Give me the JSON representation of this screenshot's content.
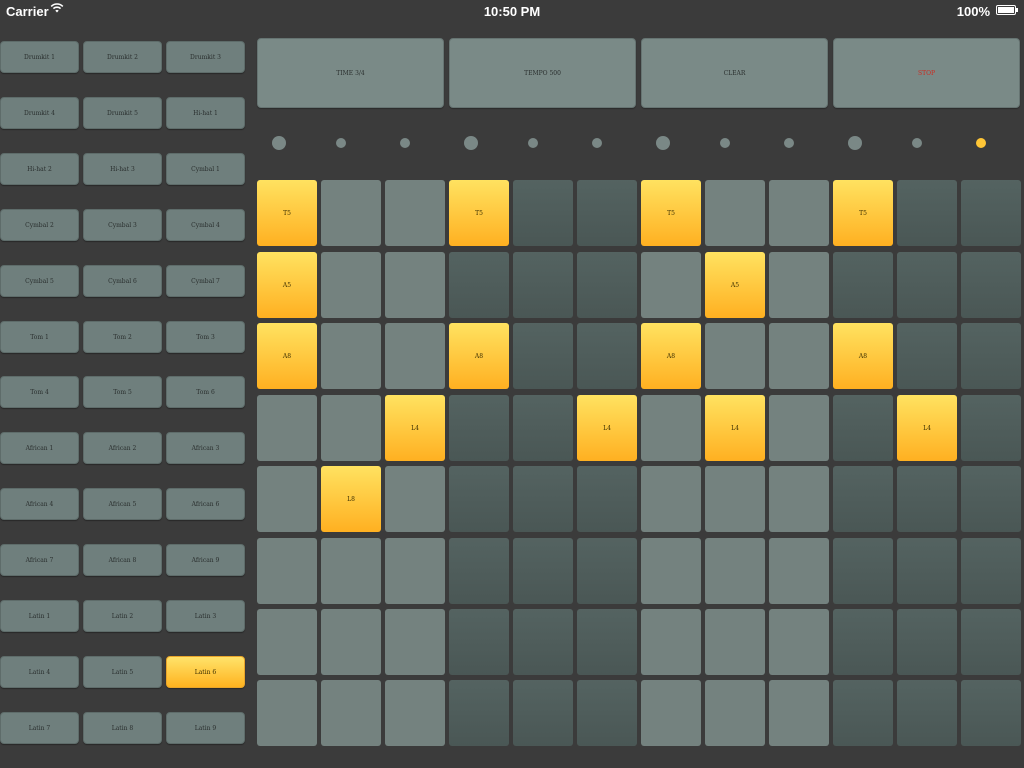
{
  "status_bar": {
    "carrier": "Carrier",
    "time": "10:50 PM",
    "battery": "100%"
  },
  "sounds": [
    "Drumkit 1",
    "Drumkit 2",
    "Drumkit 3",
    "Drumkit 4",
    "Drumkit 5",
    "Hi-hat 1",
    "Hi-hat 2",
    "Hi-hat 3",
    "Cymbal 1",
    "Cymbal 2",
    "Cymbal 3",
    "Cymbal 4",
    "Cymbal 5",
    "Cymbal 6",
    "Cymbal 7",
    "Tom 1",
    "Tom 2",
    "Tom 3",
    "Tom 4",
    "Tom 5",
    "Tom 6",
    "African 1",
    "African 2",
    "African 3",
    "African 4",
    "African 5",
    "African 6",
    "African 7",
    "African 8",
    "African 9",
    "Latin 1",
    "Latin 2",
    "Latin 3",
    "Latin 4",
    "Latin 5",
    "Latin 6",
    "Latin 7",
    "Latin 8",
    "Latin 9"
  ],
  "selected_sound_index": 35,
  "controls": {
    "time": "TIME 3/4",
    "tempo": "TEMPO 500",
    "clear": "CLEAR",
    "stop": "STOP"
  },
  "colors": {
    "stop_text": "#cc2a1f",
    "accent": "#ffc636",
    "pad_light": "#74827f",
    "pad_dark": "#4f5c5a"
  },
  "beat_dots": [
    {
      "size": "big"
    },
    {
      "size": "small"
    },
    {
      "size": "small"
    },
    {
      "size": "big"
    },
    {
      "size": "small"
    },
    {
      "size": "small"
    },
    {
      "size": "big"
    },
    {
      "size": "small"
    },
    {
      "size": "small"
    },
    {
      "size": "big"
    },
    {
      "size": "small"
    },
    {
      "size": "small",
      "active": true
    }
  ],
  "column_shade": [
    "light",
    "light",
    "light",
    "dark",
    "dark",
    "dark",
    "light",
    "light",
    "light",
    "dark",
    "dark",
    "dark"
  ],
  "grid": [
    [
      "T5",
      "",
      "",
      "T5",
      "",
      "",
      "T5",
      "",
      "",
      "T5",
      "",
      ""
    ],
    [
      "A5",
      "",
      "",
      "",
      "",
      "",
      "",
      "A5",
      "",
      "",
      "",
      ""
    ],
    [
      "A8",
      "",
      "",
      "A8",
      "",
      "",
      "A8",
      "",
      "",
      "A8",
      "",
      ""
    ],
    [
      "",
      "",
      "L4",
      "",
      "",
      "L4",
      "",
      "L4",
      "",
      "",
      "L4",
      ""
    ],
    [
      "",
      "L8",
      "",
      "",
      "",
      "",
      "",
      "",
      "",
      "",
      "",
      ""
    ],
    [
      "",
      "",
      "",
      "",
      "",
      "",
      "",
      "",
      "",
      "",
      "",
      ""
    ],
    [
      "",
      "",
      "",
      "",
      "",
      "",
      "",
      "",
      "",
      "",
      "",
      ""
    ],
    [
      "",
      "",
      "",
      "",
      "",
      "",
      "",
      "",
      "",
      "",
      "",
      ""
    ]
  ]
}
